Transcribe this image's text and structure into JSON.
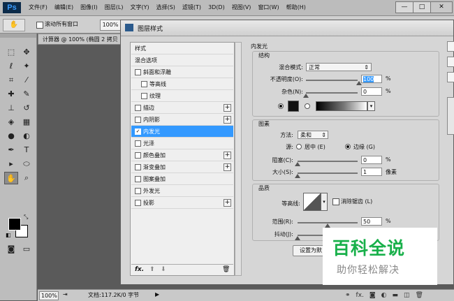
{
  "app": {
    "logo": "Ps"
  },
  "menu": [
    "文件(F)",
    "编辑(E)",
    "图像(I)",
    "图层(L)",
    "文字(Y)",
    "选择(S)",
    "滤镜(T)",
    "3D(D)",
    "视图(V)",
    "窗口(W)",
    "帮助(H)"
  ],
  "window_buttons": {
    "minimize": "—",
    "maximize": "□",
    "close": "✕"
  },
  "options_bar": {
    "hand_glyph": "✋",
    "scroll_all_label": "滚动所有窗口",
    "zoom": "100%"
  },
  "doc_tab": "计算器 @ 100% (椭圆 2 拷贝",
  "status": {
    "zoom": "100%",
    "doc": "文档:117.2K/0 字节",
    "arrow": "▶"
  },
  "dialog": {
    "title": "图层样式",
    "styles_header": "样式",
    "blend_options": "混合选项",
    "items": [
      {
        "label": "斜面和浮雕",
        "checked": false,
        "plus": false
      },
      {
        "label": "等高线",
        "checked": false,
        "plus": false
      },
      {
        "label": "纹理",
        "checked": false,
        "plus": false
      },
      {
        "label": "描边",
        "checked": false,
        "plus": true
      },
      {
        "label": "内阴影",
        "checked": false,
        "plus": true
      },
      {
        "label": "内发光",
        "checked": true,
        "plus": false
      },
      {
        "label": "光泽",
        "checked": false,
        "plus": false
      },
      {
        "label": "颜色叠加",
        "checked": false,
        "plus": true
      },
      {
        "label": "渐变叠加",
        "checked": false,
        "plus": true
      },
      {
        "label": "图案叠加",
        "checked": false,
        "plus": false
      },
      {
        "label": "外发光",
        "checked": false,
        "plus": false
      },
      {
        "label": "投影",
        "checked": false,
        "plus": true
      }
    ],
    "list_footer": {
      "fx": "fx.",
      "up": "⬆",
      "down": "⬇",
      "trash": "🗑"
    },
    "panel_title": "内发光",
    "structure": {
      "title": "结构",
      "blend_mode_label": "混合模式:",
      "blend_mode_value": "正常",
      "opacity_label": "不透明度(O):",
      "opacity_value": "100",
      "noise_label": "杂色(N):",
      "noise_value": "0",
      "percent": "%"
    },
    "elements": {
      "title": "图素",
      "method_label": "方法:",
      "method_value": "柔和",
      "source_label": "源:",
      "source_center": "居中 (E)",
      "source_edge": "边缘 (G)",
      "choke_label": "阻塞(C):",
      "choke_value": "0",
      "size_label": "大小(S):",
      "size_value": "1",
      "pixels": "像素"
    },
    "quality": {
      "title": "品质",
      "contour_label": "等高线:",
      "antialias_label": "消除锯齿 (L)",
      "range_label": "范围(R):",
      "range_value": "50",
      "jitter_label": "抖动(J):",
      "jitter_value": "0"
    },
    "set_default_button": "设置为默"
  },
  "watermark": {
    "big": "百科全说",
    "small": "助你轻松解决"
  }
}
